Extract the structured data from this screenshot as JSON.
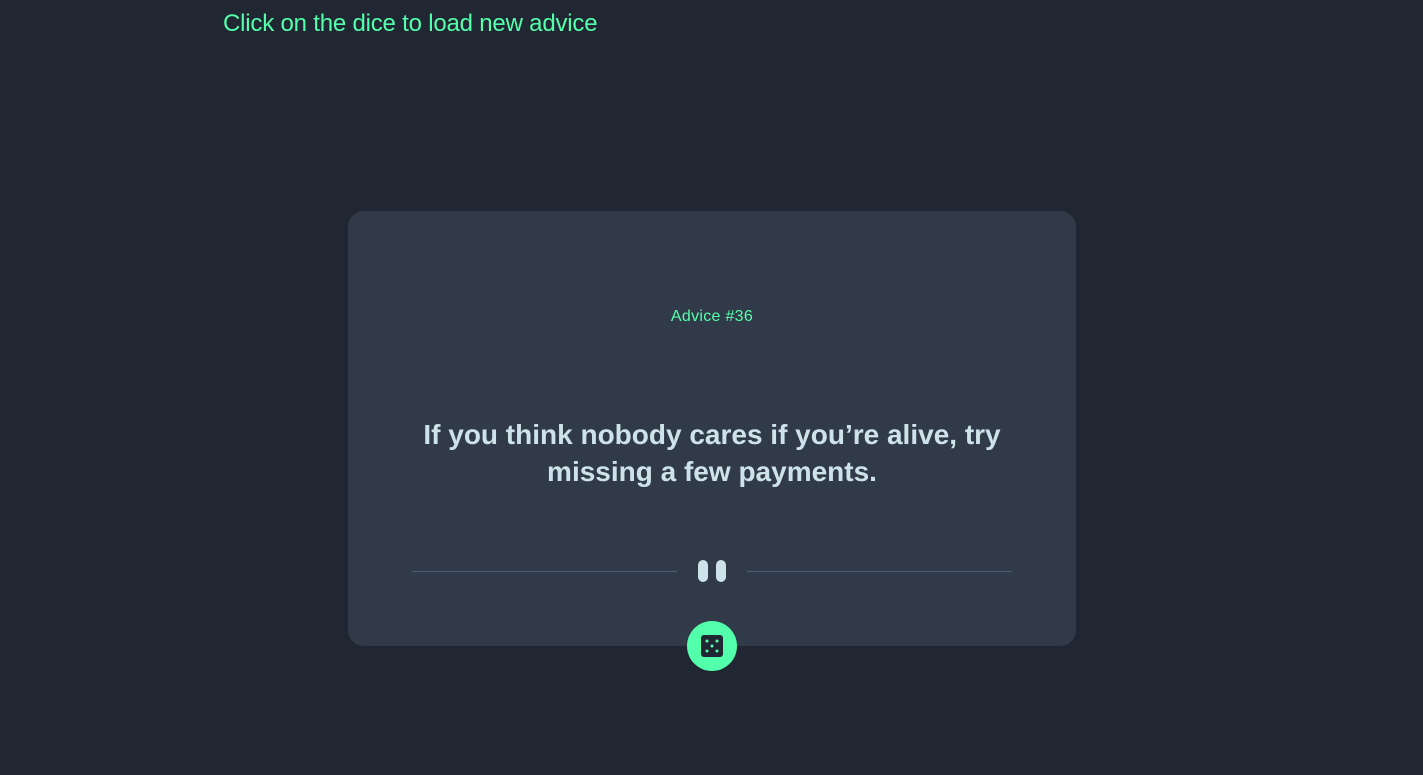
{
  "page": {
    "hint": "Click on the dice to load new advice"
  },
  "card": {
    "advice_id_label": "Advice #36",
    "advice_text": "If you think nobody cares if you’re alive, try missing a few payments."
  },
  "icons": {
    "divider": "pause-icon",
    "dice": "dice-icon"
  },
  "colors": {
    "background": "#202632",
    "card": "#313a48",
    "accent": "#53ffaa",
    "text": "#cee3e9",
    "divider": "#4f5d74"
  }
}
